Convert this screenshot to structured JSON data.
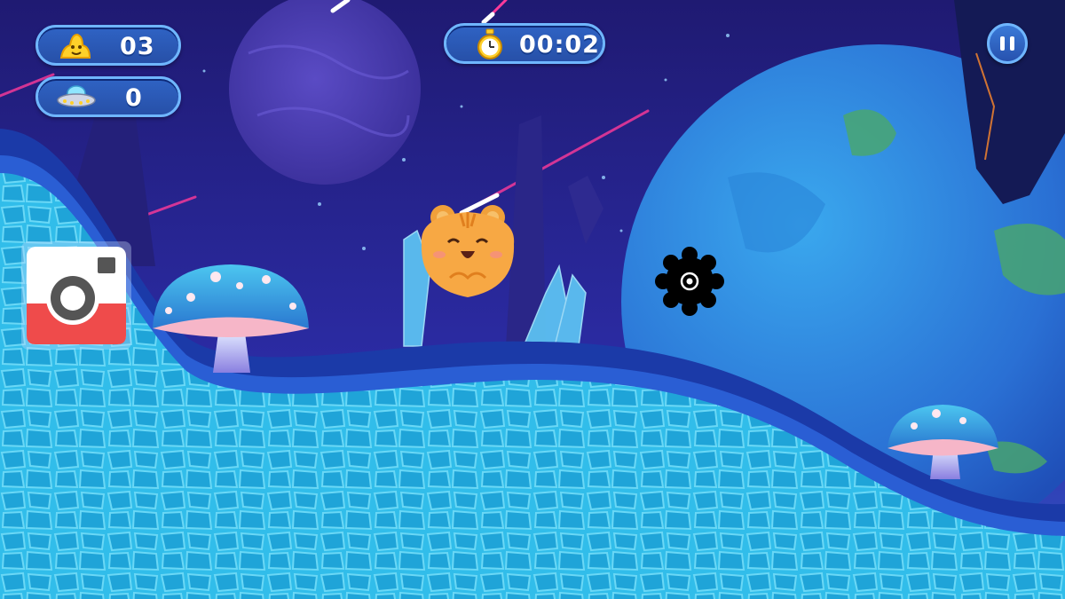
{
  "hud": {
    "coins_count": "03",
    "ufo_count": "0",
    "timer": "00:02"
  },
  "icons": {
    "coin": "coin-pile-icon",
    "ufo": "ufo-icon",
    "timer": "stopwatch-icon",
    "pause": "pause-icon",
    "camera": "camera-icon"
  },
  "colors": {
    "sky": "#2a1f8f",
    "ground": "#2fc0e8",
    "ground_edge": "#1a3aa8",
    "hud_fill": "#2f63c4",
    "hud_border": "#6fb6ff",
    "player": "#f7a844",
    "camera_red": "#ef4b4b"
  }
}
